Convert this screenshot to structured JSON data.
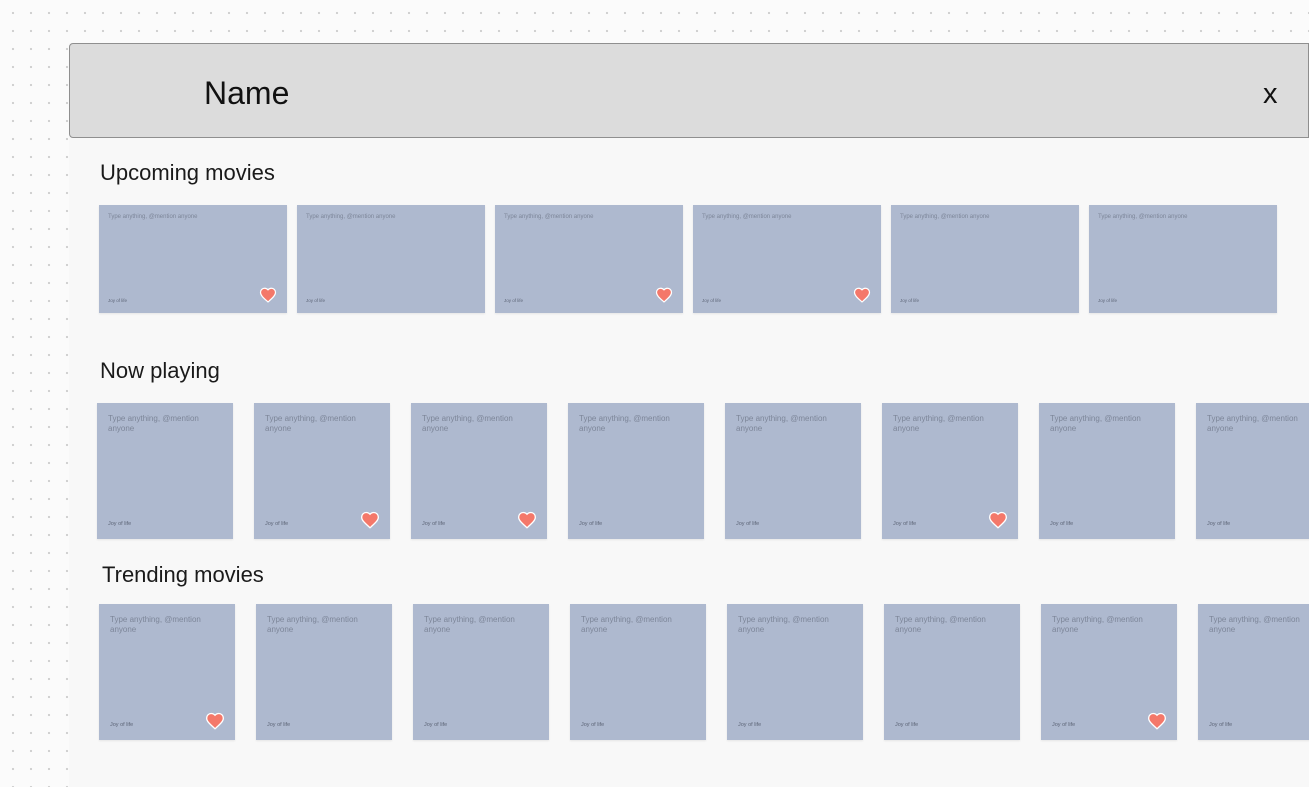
{
  "header": {
    "title": "Name",
    "close_label": "x"
  },
  "heart_color": "#f4786a",
  "sections": [
    {
      "title": "Upcoming movies",
      "cards": [
        {
          "text": "Type anything, @mention anyone",
          "subtitle": "Joy of life",
          "favorited": true
        },
        {
          "text": "Type anything, @mention anyone",
          "subtitle": "Joy of life",
          "favorited": false
        },
        {
          "text": "Type anything, @mention anyone",
          "subtitle": "Joy of life",
          "favorited": true
        },
        {
          "text": "Type anything, @mention anyone",
          "subtitle": "Joy of life",
          "favorited": true
        },
        {
          "text": "Type anything, @mention anyone",
          "subtitle": "Joy of life",
          "favorited": false
        },
        {
          "text": "Type anything, @mention anyone",
          "subtitle": "Joy of life",
          "favorited": false
        }
      ]
    },
    {
      "title": "Now playing",
      "cards": [
        {
          "text": "Type anything, @mention anyone",
          "subtitle": "Joy of life",
          "favorited": false
        },
        {
          "text": "Type anything, @mention anyone",
          "subtitle": "Joy of life",
          "favorited": true
        },
        {
          "text": "Type anything, @mention anyone",
          "subtitle": "Joy of life",
          "favorited": true
        },
        {
          "text": "Type anything, @mention anyone",
          "subtitle": "Joy of life",
          "favorited": false
        },
        {
          "text": "Type anything, @mention anyone",
          "subtitle": "Joy of life",
          "favorited": false
        },
        {
          "text": "Type anything, @mention anyone",
          "subtitle": "Joy of life",
          "favorited": true
        },
        {
          "text": "Type anything, @mention anyone",
          "subtitle": "Joy of life",
          "favorited": false
        },
        {
          "text": "Type anything, @mention anyone",
          "subtitle": "Joy of life",
          "favorited": false
        }
      ]
    },
    {
      "title": "Trending movies",
      "cards": [
        {
          "text": "Type anything, @mention anyone",
          "subtitle": "Joy of life",
          "favorited": true
        },
        {
          "text": "Type anything, @mention anyone",
          "subtitle": "Joy of life",
          "favorited": false
        },
        {
          "text": "Type anything, @mention anyone",
          "subtitle": "Joy of life",
          "favorited": false
        },
        {
          "text": "Type anything, @mention anyone",
          "subtitle": "Joy of life",
          "favorited": false
        },
        {
          "text": "Type anything, @mention anyone",
          "subtitle": "Joy of life",
          "favorited": false
        },
        {
          "text": "Type anything, @mention anyone",
          "subtitle": "Joy of life",
          "favorited": false
        },
        {
          "text": "Type anything, @mention anyone",
          "subtitle": "Joy of life",
          "favorited": true
        },
        {
          "text": "Type anything, @mention anyone",
          "subtitle": "Joy of life",
          "favorited": false
        }
      ]
    }
  ]
}
